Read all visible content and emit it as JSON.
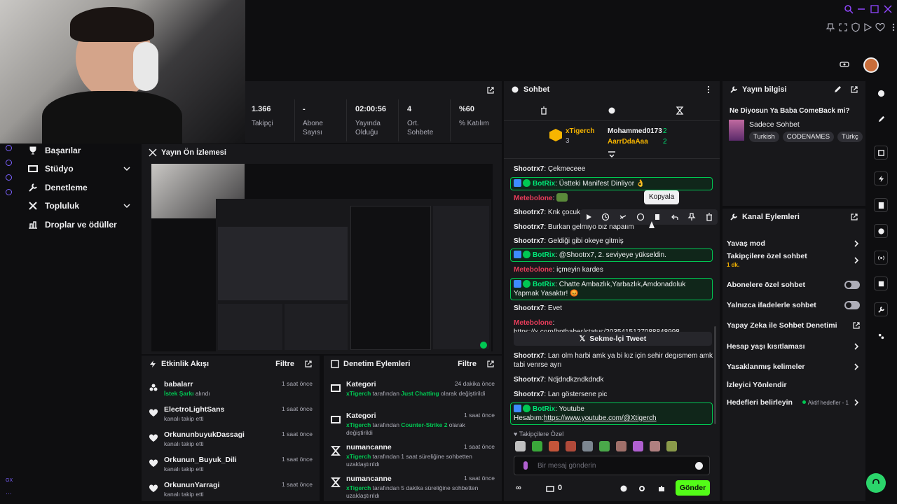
{
  "stats": [
    {
      "value": "1.366",
      "label": "Takipçi"
    },
    {
      "value": "-",
      "label": "Abone Sayısı"
    },
    {
      "value": "02:00:56",
      "label": "Yayında Olduğu"
    },
    {
      "value": "4",
      "label": "Ort. Sohbete"
    },
    {
      "value": "%60",
      "label": "% Katılım"
    }
  ],
  "nav": [
    {
      "label": "Başarılar"
    },
    {
      "label": "Stüdyo"
    },
    {
      "label": "Denetleme"
    },
    {
      "label": "Topluluk"
    },
    {
      "label": "Droplar ve ödüller"
    }
  ],
  "preview": {
    "title": "Yayın Ön İzlemesi"
  },
  "activity": {
    "title": "Etkinlik Akışı",
    "filter": "Filtre",
    "items": [
      {
        "name": "babalarr",
        "pre": "",
        "hl": "İstek Şarkı",
        "post": " alındı",
        "time": "1 saat önce",
        "icon": "bits-icon"
      },
      {
        "name": "ElectroLightSans",
        "pre": "kanalı takip etti",
        "hl": "",
        "post": "",
        "time": "1 saat önce",
        "icon": "heart-icon"
      },
      {
        "name": "OrkununbuyukDassagi",
        "pre": "kanalı takip etti",
        "hl": "",
        "post": "",
        "time": "1 saat önce",
        "icon": "heart-icon"
      },
      {
        "name": "Orkunun_Buyuk_Dili",
        "pre": "kanalı takip etti",
        "hl": "",
        "post": "",
        "time": "1 saat önce",
        "icon": "heart-icon"
      },
      {
        "name": "OrkununYarragi",
        "pre": "kanalı takip etti",
        "hl": "",
        "post": "",
        "time": "1 saat önce",
        "icon": "heart-icon"
      }
    ]
  },
  "modactions": {
    "title": "Denetim Eylemleri",
    "filter": "Filtre",
    "items": [
      {
        "name": "Kategori",
        "actor": "xTigerch",
        "pre": " tarafından ",
        "hl": "Just Chatting",
        "post": " olarak değiştirildi",
        "time": "24 dakika önce"
      },
      {
        "name": "Kategori",
        "actor": "xTigerch",
        "pre": " tarafından ",
        "hl": "Counter-Strike 2",
        "post": " olarak değiştirildi",
        "time": "1 saat önce"
      },
      {
        "name": "numancanne",
        "actor": "xTigerch",
        "pre": " tarafından 1 saat süreliğine sohbetten uzaklaştırıldı",
        "hl": "",
        "post": "",
        "time": "1 saat önce"
      },
      {
        "name": "numancanne",
        "actor": "xTigerch",
        "pre": " tarafından 5 dakika süreliğine sohbetten uzaklaştırıldı",
        "hl": "",
        "post": "",
        "time": "1 saat önce"
      }
    ]
  },
  "chat": {
    "title": "Sohbet",
    "leader1": {
      "name": "xTigerch",
      "count": "3"
    },
    "leader2": {
      "name": "Mohammed0173",
      "count": "2"
    },
    "leader3": {
      "name": "AarrDdaAaa",
      "count": "2"
    },
    "tooltip": "Kopyala",
    "messages": [
      {
        "user": "Shootrx7",
        "text": "Çekmeceee"
      },
      {
        "user": "BotRix",
        "text": "Üstteki Manifest Dinliyor 👌"
      },
      {
        "user": "Metebolone",
        "text": ""
      },
      {
        "user": "Shootrx7",
        "text": "Knk çocuk m"
      },
      {
        "user": "Shootrx7",
        "text": "Burkan gelmiyo biz napalım"
      },
      {
        "user": "Shootrx7",
        "text": "Geldiği gibi okeye gitmiş"
      },
      {
        "user": "BotRix",
        "text": "@Shootrx7, 2. seviyeye yükseldin."
      },
      {
        "user": "Metebolone",
        "text": "içmeyin kardes"
      },
      {
        "user": "BotRix",
        "text": "Chatte Ambazlık,Yarbazlık,Amdonadoluk Yapmak Yasaktır! 😡"
      },
      {
        "user": "Shootrx7",
        "text": "Evet"
      },
      {
        "user": "Metebolone",
        "text": "https://x.com/bpthaber/status/2035415127088848998"
      },
      {
        "user": "Shootrx7",
        "text": "Lan olm harbi amk ya bi kız için sehir degısmem amk tabi venrse ayrı"
      },
      {
        "user": "Shootrx7",
        "text": "Ndjdndkzndkdndk"
      },
      {
        "user": "Shootrx7",
        "text": "Lan göstersene pic"
      },
      {
        "user": "BotRix",
        "text": "Youtube Hesabım:",
        "link": "https://www.youtube.com/@Xtigerch"
      }
    ],
    "tweet_button": "Sekme-İçi Tweet",
    "followers_label": "Takipçilere Özel",
    "input_placeholder": "Bir mesaj gönderin",
    "points": "0",
    "send": "Gönder"
  },
  "streaminfo": {
    "title": "Yayın bilgisi",
    "stream_title": "Ne Diyosun Ya Baba ComeBack mi?",
    "category": "Sadece Sohbet",
    "tags": [
      "Turkish",
      "CODENAMES",
      "Türkç"
    ]
  },
  "channel_actions": {
    "title": "Kanal Eylemleri",
    "items": [
      {
        "label": "Yavaş mod",
        "sub": "",
        "control": "chevron"
      },
      {
        "label": "Takipçilere özel sohbet",
        "sub": "1 dk.",
        "control": "chevron"
      },
      {
        "label": "Abonelere özel sohbet",
        "sub": "",
        "control": "toggle"
      },
      {
        "label": "Yalnızca ifadelerle sohbet",
        "sub": "",
        "control": "toggle"
      },
      {
        "label": "Yapay Zeka ile Sohbet Denetimi",
        "sub": "",
        "control": "external"
      },
      {
        "label": "Hesap yaşı kısıtlaması",
        "sub": "",
        "control": "chevron"
      },
      {
        "label": "Yasaklanmış kelimeler",
        "sub": "",
        "control": "chevron"
      },
      {
        "label": "İzleyici Yönlendir",
        "sub": "",
        "control": "none"
      },
      {
        "label": "Hedefleri belirleyin",
        "sub": "",
        "control": "chevron",
        "status": "Aktif hedefler - 1"
      }
    ]
  },
  "colors": {
    "accent": "#53fc18",
    "bot": "#00e676",
    "mod": "#e63c5a",
    "bg": "#18181b"
  }
}
